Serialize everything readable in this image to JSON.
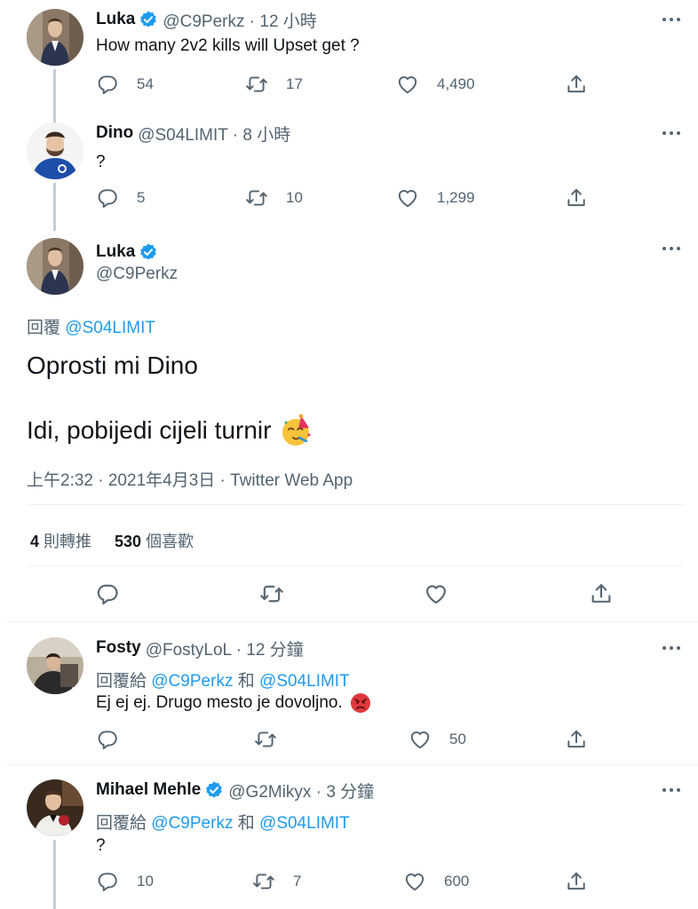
{
  "colors": {
    "accent": "#1d9bf0",
    "secondary_text": "#536471",
    "divider": "#eff3f4",
    "thread_line": "#c4cfd6"
  },
  "icons": {
    "reply": "speech-bubble",
    "retweet": "retweet-arrows",
    "like": "heart-outline",
    "share": "share-upload",
    "verified": "verified-badge",
    "more": "three-dots"
  },
  "tweets": [
    {
      "name": "Luka",
      "handle": "@C9Perkz · 12 小時",
      "text": "How many 2v2 kills will Upset get ?",
      "counts": {
        "reply": "54",
        "retweet": "17",
        "like": "4,490"
      }
    },
    {
      "name": "Dino",
      "handle": "@S04LIMIT · 8 小時",
      "text": "?",
      "counts": {
        "reply": "5",
        "retweet": "10",
        "like": "1,299"
      }
    }
  ],
  "main": {
    "name": "Luka",
    "handle": "@C9Perkz",
    "reply_prefix": "回覆",
    "reply_mention": "@S04LIMIT",
    "line1": "Oprosti mi Dino",
    "line2": "Idi, pobijedi cijeli turnir",
    "meta": "上午2:32 · 2021年4月3日 · Twitter Web App",
    "retweets_count": "4",
    "retweets_label": "則轉推",
    "likes_count": "530",
    "likes_label": "個喜歡"
  },
  "replies": [
    {
      "name": "Fosty",
      "handle": "@FostyLoL · 12 分鐘",
      "reply_prefix": "回覆給",
      "mention1": "@C9Perkz",
      "conj": "和",
      "mention2": "@S04LIMIT",
      "text": "Ej ej ej. Drugo mesto je dovoljno.",
      "counts": {
        "reply": "",
        "retweet": "",
        "like": "50"
      }
    },
    {
      "name": "Mihael Mehle",
      "handle": "@G2Mikyx · 3 分鐘",
      "reply_prefix": "回覆給",
      "mention1": "@C9Perkz",
      "conj": "和",
      "mention2": "@S04LIMIT",
      "text": "?",
      "counts": {
        "reply": "10",
        "retweet": "7",
        "like": "600"
      }
    }
  ]
}
